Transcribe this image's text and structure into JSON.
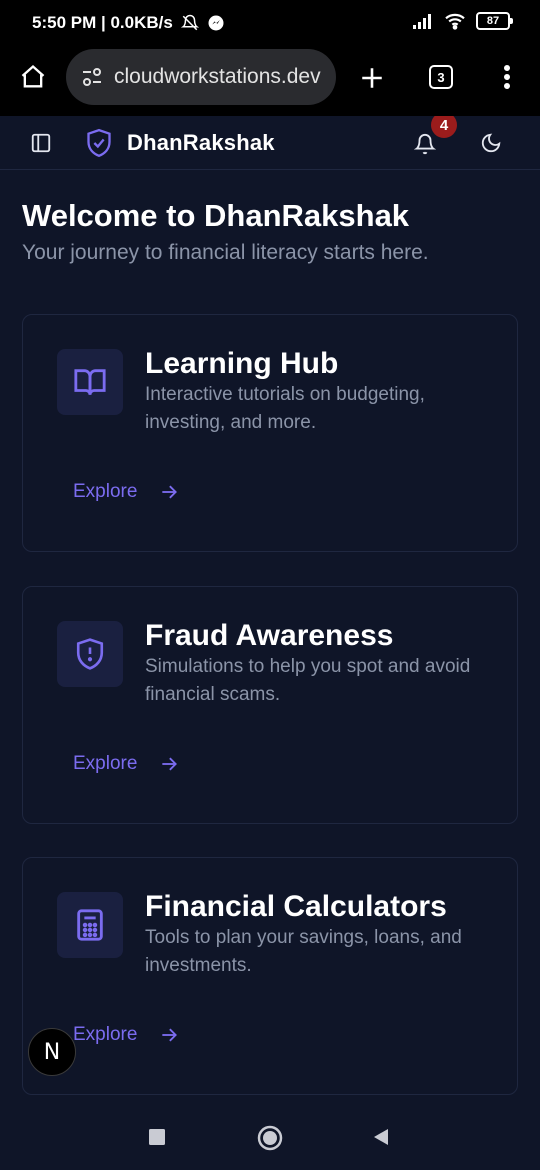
{
  "status_bar": {
    "time_speed": "5:50 PM | 0.0KB/s",
    "battery": "87"
  },
  "browser": {
    "url": "cloudworkstations.dev",
    "tab_count": "3",
    "icons": [
      "home-icon",
      "site-settings-icon",
      "new-tab-icon",
      "tab-switcher-icon",
      "more-menu-icon"
    ]
  },
  "header": {
    "brand": "DhanRakshak",
    "notification_count": "4",
    "icons": [
      "sidebar-toggle-icon",
      "shield-logo-icon",
      "bell-icon",
      "moon-icon"
    ]
  },
  "welcome": {
    "title": "Welcome to DhanRakshak",
    "subtitle": "Your journey to financial literacy starts here."
  },
  "cards": [
    {
      "title": "Learning Hub",
      "description": "Interactive tutorials on budgeting, investing, and more.",
      "action": "Explore",
      "icon": "book-open-icon"
    },
    {
      "title": "Fraud Awareness",
      "description": "Simulations to help you spot and avoid financial scams.",
      "action": "Explore",
      "icon": "shield-alert-icon"
    },
    {
      "title": "Financial Calculators",
      "description": "Tools to plan your savings, loans, and investments.",
      "action": "Explore",
      "icon": "calculator-icon"
    }
  ],
  "floating_badge": "N",
  "colors": {
    "accent": "#7b6cf0",
    "background": "#0f1528",
    "border": "#1f2740",
    "muted_text": "#8b94a8",
    "badge": "#9b1c1c"
  }
}
